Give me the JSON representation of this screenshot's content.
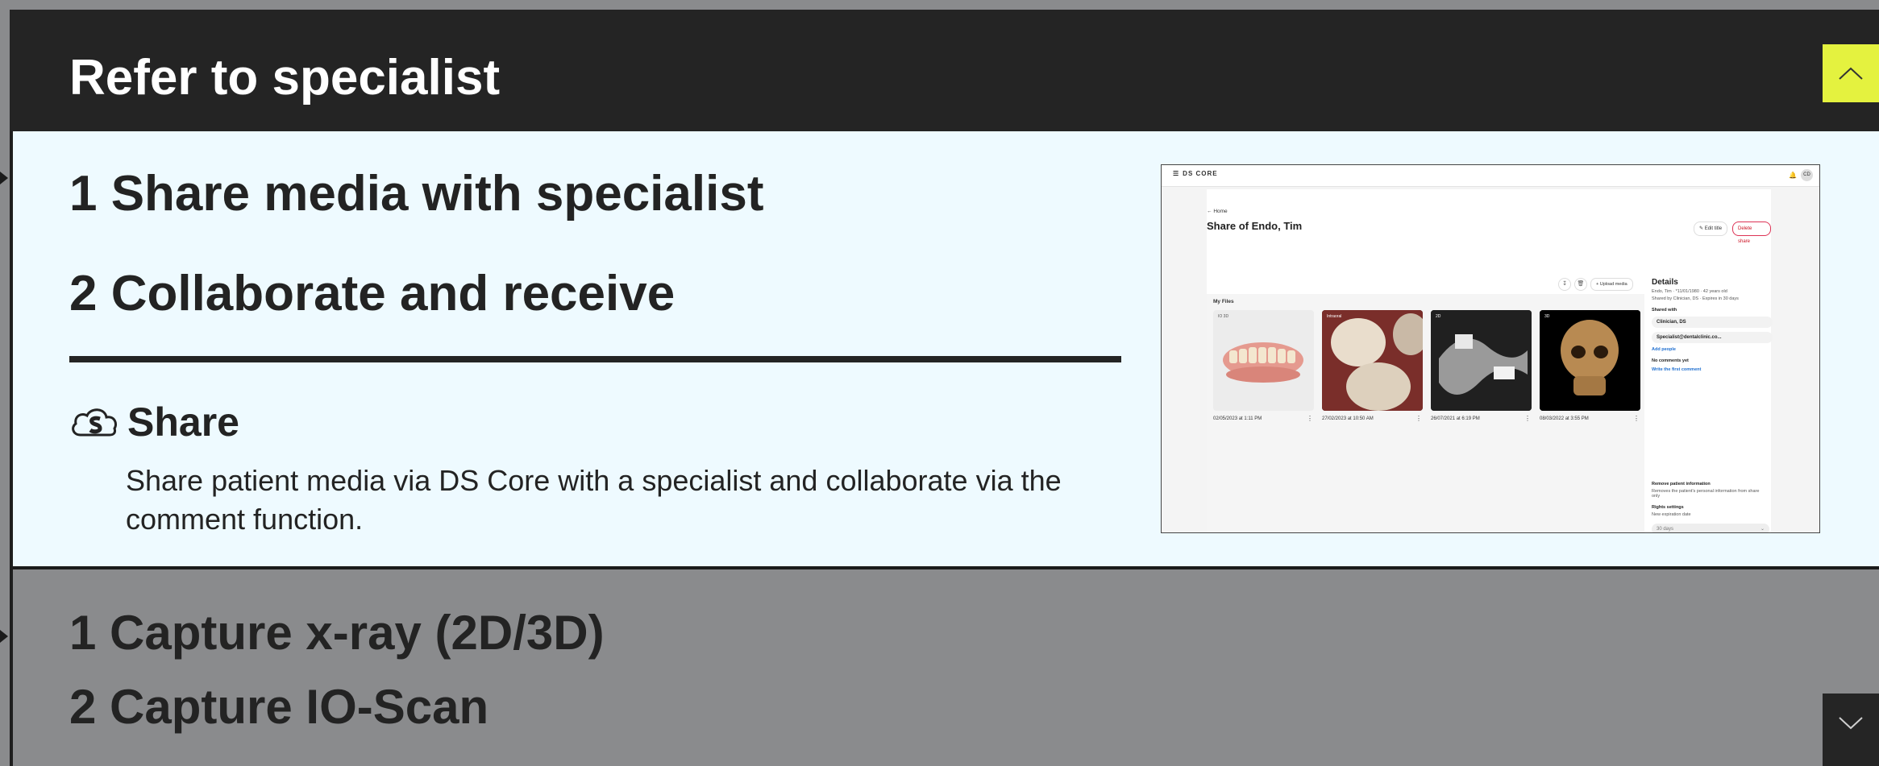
{
  "header": {
    "title": "Refer to specialist"
  },
  "active_section": {
    "steps": [
      {
        "label": "1 Share media with specialist"
      },
      {
        "label": "2 Collaborate and receive"
      }
    ],
    "share": {
      "icon": "ds-core-cloud-icon",
      "title": "Share",
      "description": "Share patient media via DS Core with a specialist and collaborate via the comment function."
    }
  },
  "screenshot": {
    "brand": "DS CORE",
    "avatar": "CD",
    "back": "Home",
    "title": "Share of Endo, Tim",
    "edit_title": "Edit title",
    "delete_share": "Delete share",
    "upload_media": "Upload media",
    "my_files": "My Files",
    "files": [
      {
        "badge": "IO 3D",
        "date": "02/05/2023 at 1:11 PM"
      },
      {
        "badge": "Intraoral",
        "date": "27/02/2023 at 10:50 AM"
      },
      {
        "badge": "2D",
        "date": "26/07/2021 at 6:19 PM"
      },
      {
        "badge": "3D",
        "date": "08/03/2022 at 3:55 PM"
      }
    ],
    "details": {
      "heading": "Details",
      "patient": "Endo, Tim · *11/01/1980 · 42 years old",
      "shared_by": "Shared by Clinician, DS · Expires in 30 days",
      "shared_with_label": "Shared with",
      "people": [
        "Clinician, DS",
        "Specialist@dentalclinic.co..."
      ],
      "add_people": "Add people",
      "no_comments": "No comments yet",
      "write_comment": "Write the first comment",
      "remove_info": "Remove patient information",
      "remove_info_desc": "Removes the patient's personal information from share only",
      "rights_settings": "Rights settings",
      "expiration_label": "New expiration date",
      "expiration_value": "30 days"
    }
  },
  "lower_section": {
    "steps": [
      {
        "label": "1 Capture x-ray (2D/3D)"
      },
      {
        "label": "2 Capture IO-Scan"
      }
    ]
  },
  "colors": {
    "header_bg": "#242424",
    "accent": "#e4f23f",
    "panel_bg": "#eefaff",
    "inactive_bg": "#8a8b8d"
  }
}
